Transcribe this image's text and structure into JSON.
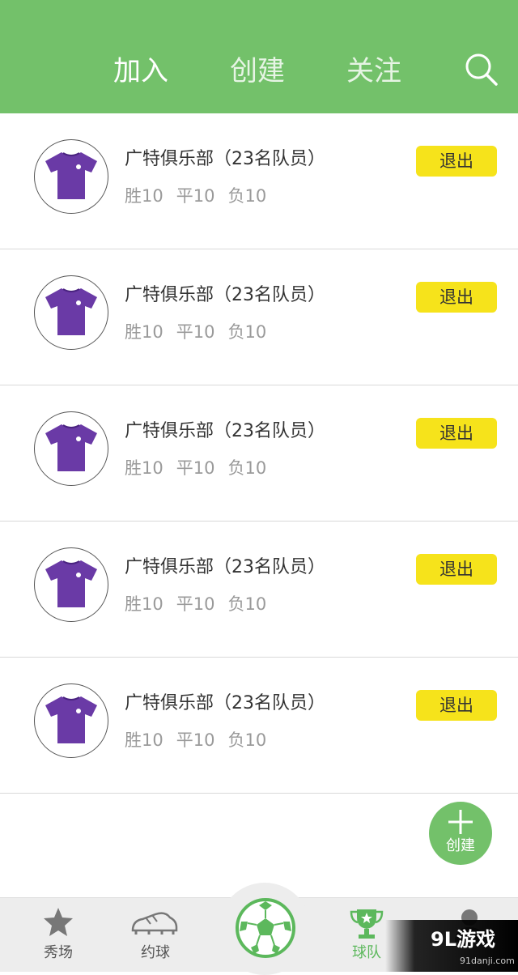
{
  "header": {
    "tabs": [
      {
        "label": "加入",
        "active": true
      },
      {
        "label": "创建",
        "active": false
      },
      {
        "label": "关注",
        "active": false
      }
    ],
    "search_icon": "search-icon",
    "background_color": "#73c16a"
  },
  "teams": [
    {
      "name": "广特俱乐部（23名队员）",
      "win": "胜10",
      "draw": "平10",
      "loss": "负10",
      "action": "退出"
    },
    {
      "name": "广特俱乐部（23名队员）",
      "win": "胜10",
      "draw": "平10",
      "loss": "负10",
      "action": "退出"
    },
    {
      "name": "广特俱乐部（23名队员）",
      "win": "胜10",
      "draw": "平10",
      "loss": "负10",
      "action": "退出"
    },
    {
      "name": "广特俱乐部（23名队员）",
      "win": "胜10",
      "draw": "平10",
      "loss": "负10",
      "action": "退出"
    },
    {
      "name": "广特俱乐部（23名队员）",
      "win": "胜10",
      "draw": "平10",
      "loss": "负10",
      "action": "退出"
    }
  ],
  "fab": {
    "label": "创建",
    "icon": "plus-icon"
  },
  "bottom_nav": {
    "items": [
      {
        "label": "秀场",
        "icon": "star-icon",
        "active": false
      },
      {
        "label": "约球",
        "icon": "cleat-icon",
        "active": false
      },
      {
        "label": "球队",
        "icon": "trophy-icon",
        "active": true
      },
      {
        "label": "",
        "icon": "user-icon",
        "active": false
      }
    ],
    "center_icon": "soccer-ball-icon"
  },
  "watermark": {
    "brand": "9L游戏",
    "url": "91danji.com"
  },
  "colors": {
    "accent_green": "#73c16a",
    "quit_yellow": "#f6e31b",
    "jersey_purple": "#6a3aa6"
  }
}
